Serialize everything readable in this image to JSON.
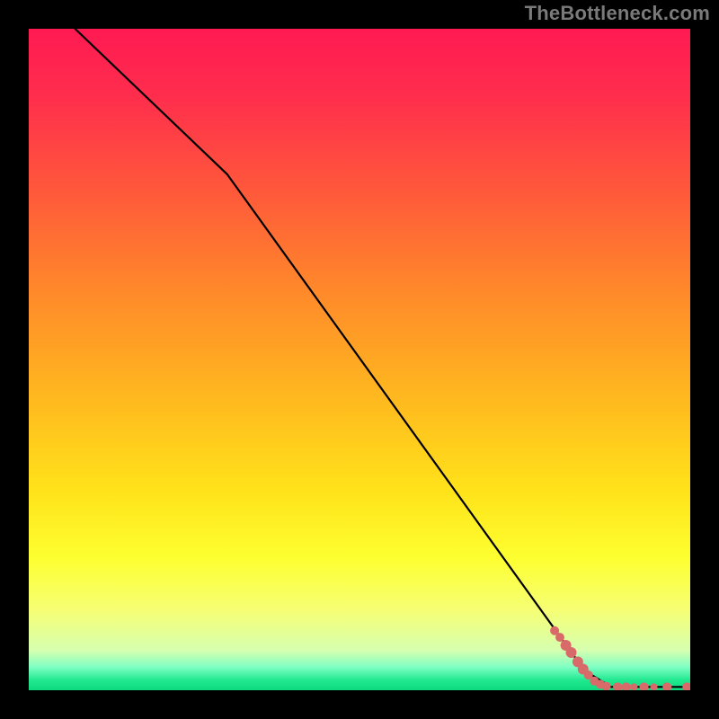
{
  "watermark": "TheBottleneck.com",
  "gradient": {
    "stops": [
      {
        "offset": 0.0,
        "color": "#ff1a52"
      },
      {
        "offset": 0.1,
        "color": "#ff2d4d"
      },
      {
        "offset": 0.25,
        "color": "#ff5a3a"
      },
      {
        "offset": 0.4,
        "color": "#ff8a2a"
      },
      {
        "offset": 0.55,
        "color": "#ffb61f"
      },
      {
        "offset": 0.7,
        "color": "#ffe31a"
      },
      {
        "offset": 0.8,
        "color": "#fdff30"
      },
      {
        "offset": 0.88,
        "color": "#f6ff75"
      },
      {
        "offset": 0.94,
        "color": "#d6ffb0"
      },
      {
        "offset": 0.965,
        "color": "#7fffc4"
      },
      {
        "offset": 0.985,
        "color": "#1fe88f"
      },
      {
        "offset": 1.0,
        "color": "#0fd97f"
      }
    ]
  },
  "chart_data": {
    "type": "line",
    "title": "",
    "xlabel": "",
    "ylabel": "",
    "xlim": [
      0,
      100
    ],
    "ylim": [
      0,
      100
    ],
    "series": [
      {
        "name": "curve",
        "x": [
          7,
          30,
          84,
          88,
          100
        ],
        "y": [
          100,
          78,
          3,
          0.5,
          0.5
        ]
      }
    ],
    "markers": {
      "name": "highlight-points",
      "color": "#d86a6a",
      "points": [
        {
          "x": 79.5,
          "y": 9.0,
          "r": 5
        },
        {
          "x": 80.3,
          "y": 8.0,
          "r": 5
        },
        {
          "x": 81.2,
          "y": 6.8,
          "r": 6
        },
        {
          "x": 82.0,
          "y": 5.7,
          "r": 6
        },
        {
          "x": 83.0,
          "y": 4.3,
          "r": 6
        },
        {
          "x": 83.8,
          "y": 3.2,
          "r": 6
        },
        {
          "x": 84.6,
          "y": 2.3,
          "r": 5
        },
        {
          "x": 85.5,
          "y": 1.4,
          "r": 5
        },
        {
          "x": 86.4,
          "y": 0.9,
          "r": 5
        },
        {
          "x": 87.3,
          "y": 0.6,
          "r": 5
        },
        {
          "x": 89.0,
          "y": 0.5,
          "r": 5
        },
        {
          "x": 90.3,
          "y": 0.5,
          "r": 5
        },
        {
          "x": 91.5,
          "y": 0.5,
          "r": 4
        },
        {
          "x": 93.0,
          "y": 0.5,
          "r": 5
        },
        {
          "x": 94.5,
          "y": 0.5,
          "r": 4
        },
        {
          "x": 96.5,
          "y": 0.5,
          "r": 5
        },
        {
          "x": 99.5,
          "y": 0.5,
          "r": 5
        }
      ]
    }
  }
}
